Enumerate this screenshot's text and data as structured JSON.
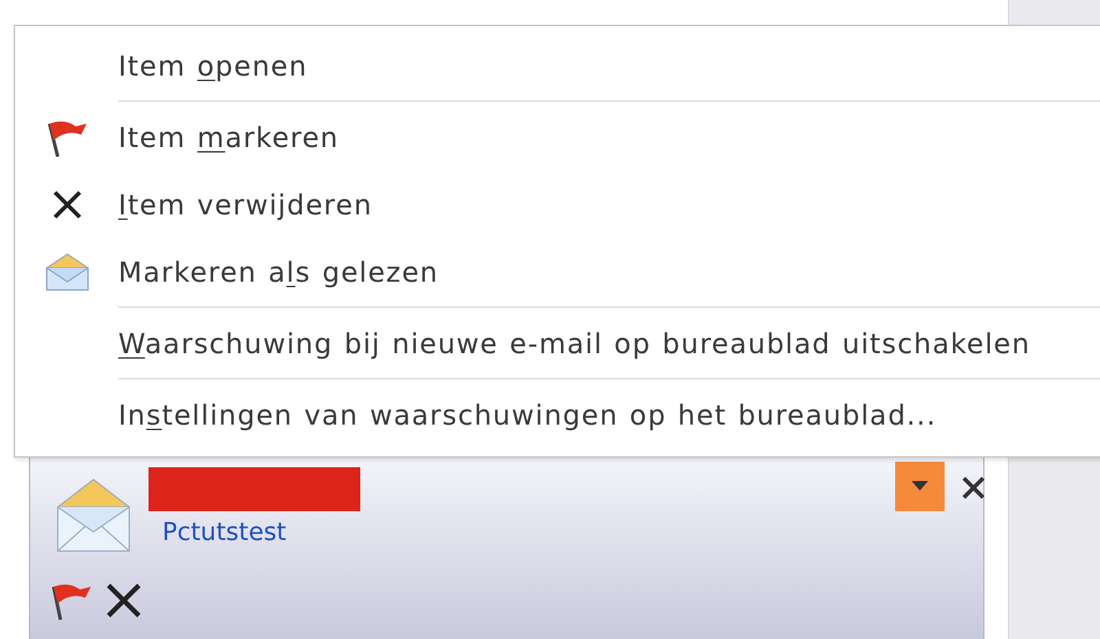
{
  "menu": {
    "items": [
      {
        "kind": "text",
        "before": "Item ",
        "key": "o",
        "after": "penen",
        "separator_after": true
      },
      {
        "kind": "flag",
        "before": "Item ",
        "key": "m",
        "after": "arkeren",
        "separator_after": false
      },
      {
        "kind": "delete",
        "key": "I",
        "after": "tem verwijderen",
        "separator_after": false
      },
      {
        "kind": "envelope",
        "before": "Markeren a",
        "key": "l",
        "after": "s gelezen",
        "separator_after": true
      },
      {
        "kind": "text",
        "key": "W",
        "after": "aarschuwing bij nieuwe e-mail op bureaublad uitschakelen",
        "separator_after": true
      },
      {
        "kind": "text",
        "before": "In",
        "key": "s",
        "after": "tellingen van waarschuwingen op het bureaublad...",
        "separator_after": false
      }
    ]
  },
  "alert": {
    "sender": "Pctutstest",
    "options_open": true
  }
}
